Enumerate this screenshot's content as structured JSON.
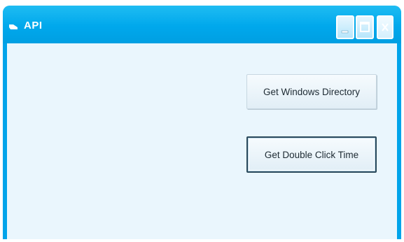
{
  "window": {
    "title": "API",
    "app_icon": "window-app-icon",
    "controls": {
      "minimize": "minimize-icon",
      "maximize": "maximize-icon",
      "close": "close-icon"
    }
  },
  "buttons": {
    "get_windows_directory": "Get Windows Directory",
    "get_double_click_time": "Get Double Click Time"
  },
  "colors": {
    "titlebar": "#00a8ec",
    "client_background": "#eaf6fd",
    "button_face": "#eef6fb"
  }
}
